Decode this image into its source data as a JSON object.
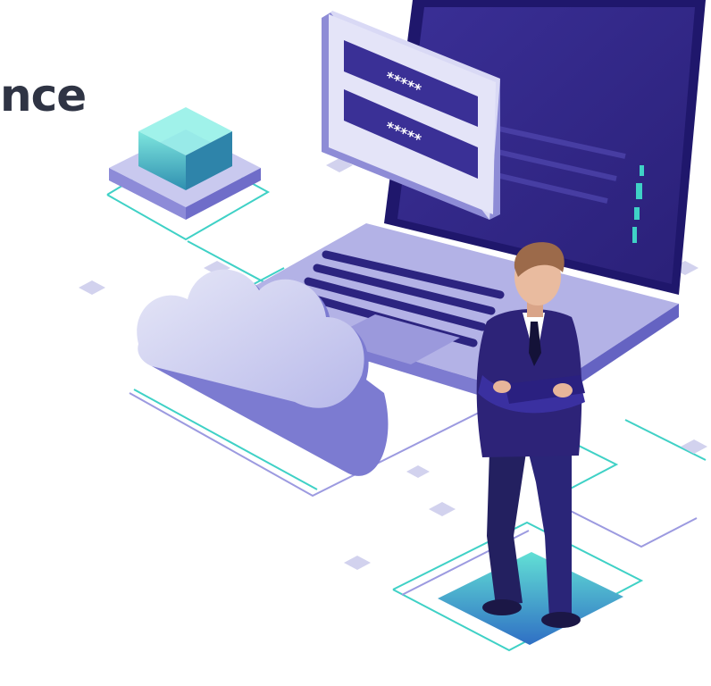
{
  "headline": {
    "visible_text": "nce"
  },
  "illustration": {
    "password_dialog": {
      "field_1_mask": "*****",
      "field_2_mask": "*****"
    },
    "colors": {
      "text_dark": "#2f3444",
      "accent_teal": "#3fd1c6",
      "accent_purple": "#3a2f96",
      "laptop_body": "#b3b2e6",
      "screen_dark": "#2f2587",
      "cloud_light": "#d7d8f2",
      "suit_navy": "#2d2378"
    }
  }
}
